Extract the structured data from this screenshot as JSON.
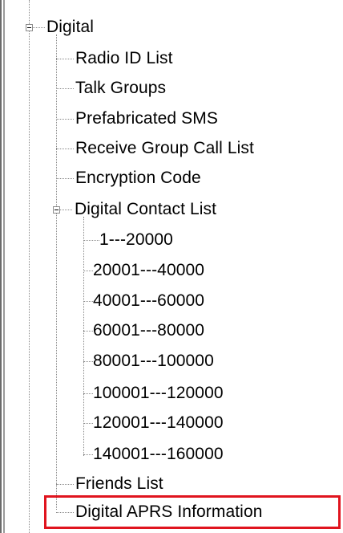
{
  "tree": {
    "root": {
      "label": "Digital",
      "expanded": true
    },
    "children": [
      {
        "label": "Radio ID List"
      },
      {
        "label": "Talk Groups"
      },
      {
        "label": "Prefabricated SMS"
      },
      {
        "label": "Receive Group Call List"
      },
      {
        "label": "Encryption Code"
      },
      {
        "label": "Digital Contact List",
        "expanded": true,
        "children": [
          {
            "label": "1---20000"
          },
          {
            "label": "20001---40000"
          },
          {
            "label": "40001---60000"
          },
          {
            "label": "60001---80000"
          },
          {
            "label": "80001---100000"
          },
          {
            "label": "100001---120000"
          },
          {
            "label": "120001---140000"
          },
          {
            "label": "140001---160000"
          }
        ]
      },
      {
        "label": "Friends List"
      },
      {
        "label": "Digital APRS Information",
        "highlighted": true
      }
    ]
  },
  "colors": {
    "highlight": "#e0141e",
    "tree_lines": "#8a8a8a"
  }
}
